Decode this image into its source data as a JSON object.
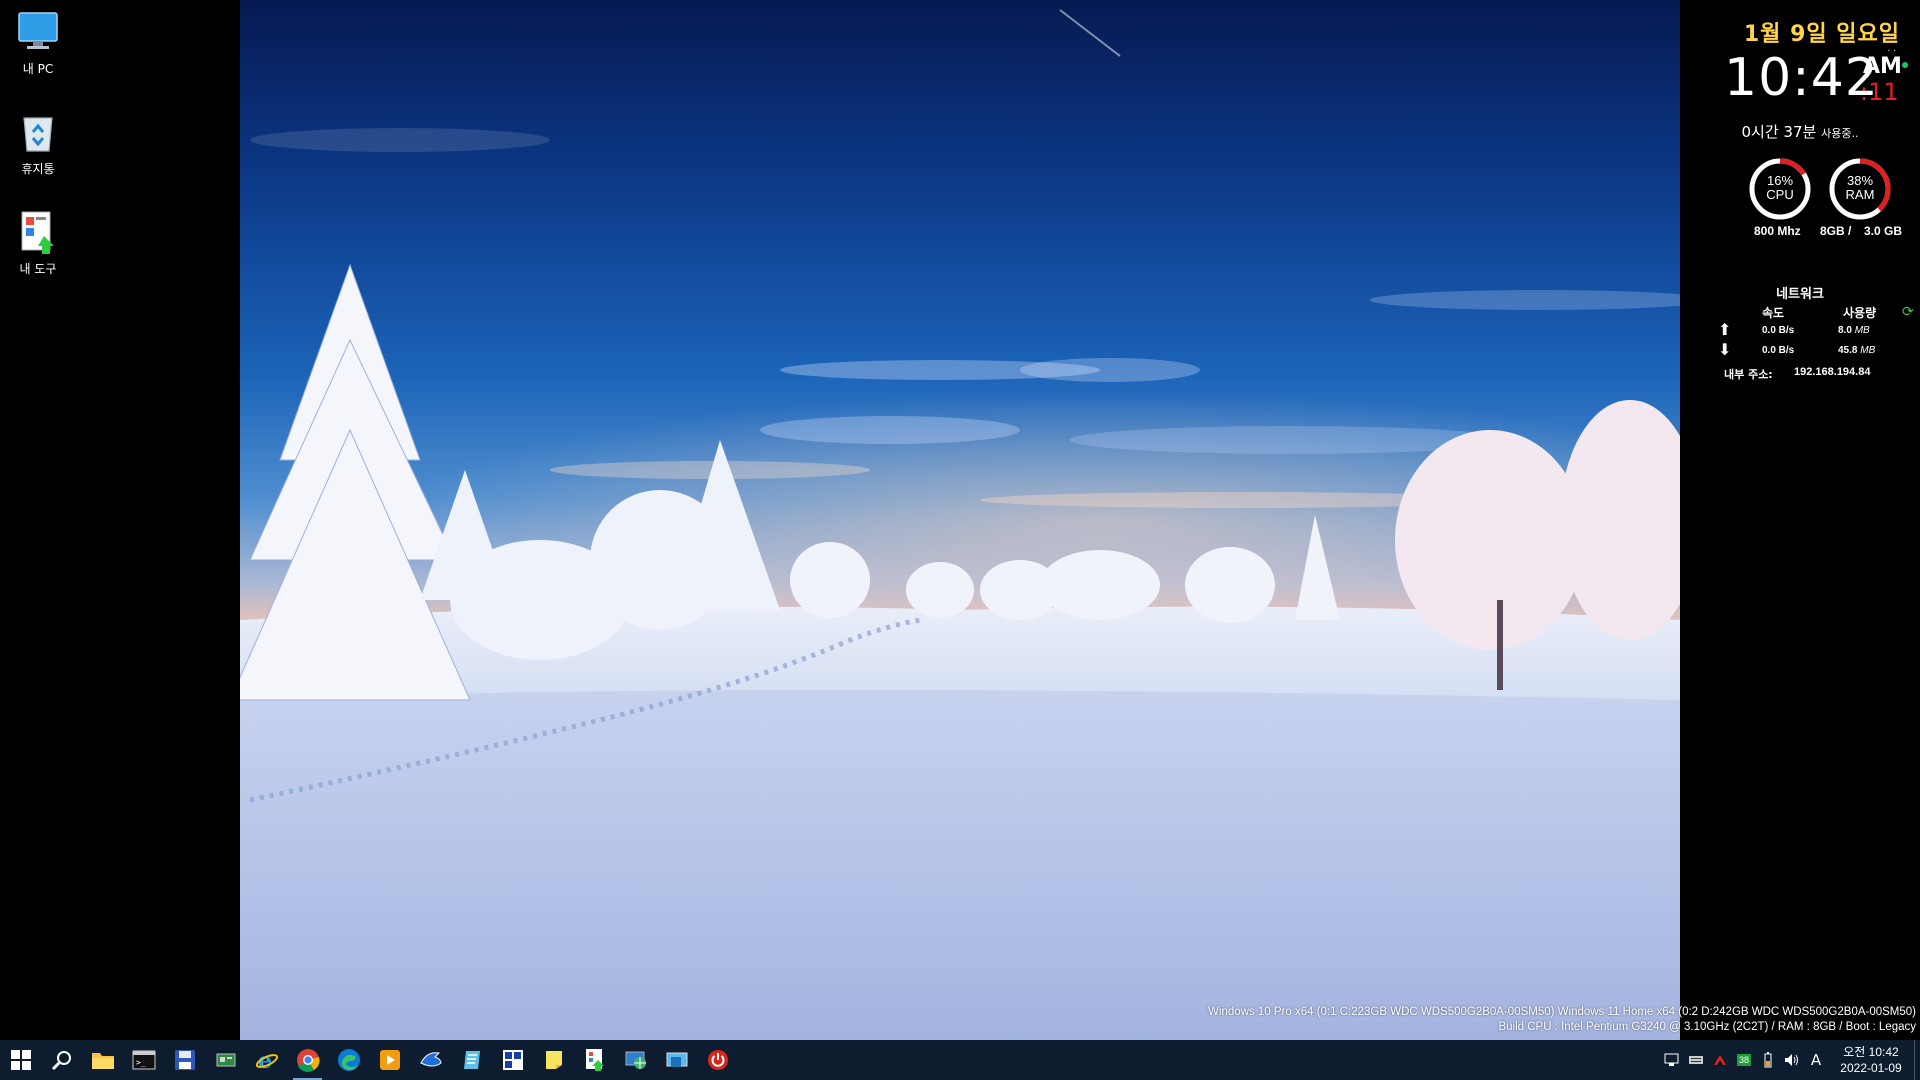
{
  "desktop": {
    "icons": [
      {
        "label": "내 PC",
        "icon": "monitor-icon"
      },
      {
        "label": "휴지통",
        "icon": "recycle-bin-icon"
      },
      {
        "label": "내 도구",
        "icon": "tools-icon"
      }
    ]
  },
  "widget": {
    "date": "1월 9일 일요일",
    "dots": ". .",
    "time": "10:42",
    "ampm": "AM",
    "seconds": ":11",
    "uptime": "0시간 37분",
    "uptime_suffix": "사용중..",
    "cpu": {
      "percent_label": "16%",
      "name": "CPU",
      "value": 0.16,
      "freq": "800 Mhz"
    },
    "ram": {
      "percent_label": "38%",
      "name": "RAM",
      "value": 0.38,
      "total": "8GB /",
      "used": "3.0 GB"
    },
    "network": {
      "title": "네트워크",
      "col_speed": "속도",
      "col_usage": "사용량",
      "up_speed": "0.0 B/s",
      "up_usage": "8.0",
      "up_unit": "MB",
      "down_speed": "0.0 B/s",
      "down_usage": "45.8",
      "down_unit": "MB",
      "ip_label": "내부 주소:",
      "ip": "192.168.194.84"
    },
    "colors": {
      "date": "#ffd34a",
      "seconds": "#e02020",
      "gauge_arc": "#e02020",
      "gauge_track": "#ffffff",
      "refresh": "#3cc43c"
    }
  },
  "sysinfo": {
    "line1": "Windows 10 Pro x64 (0:1 C:223GB WDC  WDS500G2B0A-00SM50) Windows 11 Home x64 (0:2 D:242GB WDC  WDS500G2B0A-00SM50)",
    "line2": "Build CPU : Intel Pentium G3240 @ 3.10GHz (2C2T) / RAM : 8GB / Boot : Legacy"
  },
  "taskbar": {
    "apps": [
      "windows-start-icon",
      "search-icon",
      "file-explorer-icon",
      "terminal-icon",
      "floppy-save-icon",
      "hardware-info-icon",
      "internet-explorer-icon",
      "chrome-icon",
      "edge-icon",
      "media-player-icon",
      "shark-app-icon",
      "notes-app-icon",
      "puzzle-app-icon",
      "sticky-note-icon",
      "installer-icon",
      "network-globe-icon",
      "remote-desktop-icon",
      "power-icon"
    ],
    "tray": {
      "battery_badge": "38",
      "ime": "A",
      "time": "오전 10:42",
      "date": "2022-01-09"
    }
  }
}
